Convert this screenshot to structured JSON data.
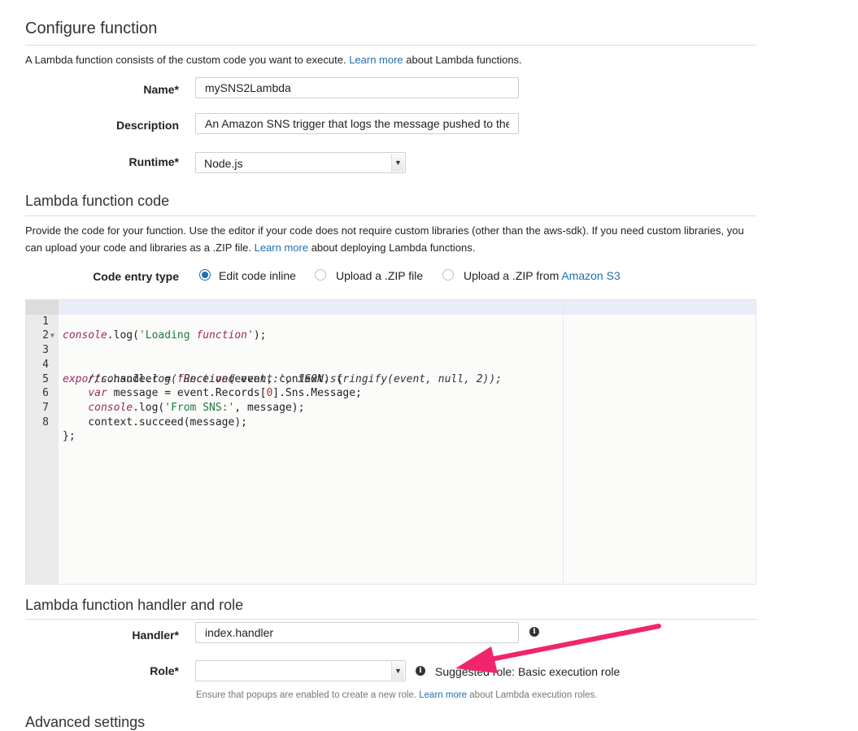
{
  "configure": {
    "title": "Configure function",
    "desc_before": "A Lambda function consists of the custom code you want to execute. ",
    "desc_link": "Learn more",
    "desc_after": " about Lambda functions.",
    "name_label": "Name*",
    "name_value": "mySNS2Lambda",
    "description_label": "Description",
    "description_value": "An Amazon SNS trigger that logs the message pushed to the",
    "runtime_label": "Runtime*",
    "runtime_value": "Node.js"
  },
  "code_section": {
    "title": "Lambda function code",
    "desc_before": "Provide the code for your function. Use the editor if your code does not require custom libraries (other than the aws-sdk). If you need custom libraries, you can upload your code and libraries as a .ZIP file. ",
    "desc_link": "Learn more",
    "desc_after": " about deploying Lambda functions.",
    "entry_type_label": "Code entry type",
    "options": [
      {
        "label": "Edit code inline",
        "selected": true
      },
      {
        "label": "Upload a .ZIP file",
        "selected": false
      },
      {
        "label_before": "Upload a .ZIP from ",
        "label_link": "Amazon S3",
        "selected": false
      }
    ]
  },
  "editor": {
    "line_numbers": [
      "1",
      "2",
      "3",
      "4",
      "5",
      "6",
      "7",
      "8"
    ],
    "lines": [
      "console.log('Loading function');",
      "",
      "exports.handler = function(event, context) {",
      "    //console.log('Received event:', JSON.stringify(event, null, 2));",
      "    var message = event.Records[0].Sns.Message;",
      "    console.log('From SNS:', message);",
      "    context.succeed(message);",
      "};"
    ]
  },
  "handler_section": {
    "title": "Lambda function handler and role",
    "handler_label": "Handler*",
    "handler_value": "index.handler",
    "role_label": "Role*",
    "role_value": "",
    "suggested_role": "Suggested role: Basic execution role",
    "note_before": "Ensure that popups are enabled to create a new role. ",
    "note_link": "Learn more",
    "note_after": " about Lambda execution roles."
  },
  "advanced": {
    "title": "Advanced settings"
  },
  "colors": {
    "link": "#1f6fb2",
    "annotation_arrow": "#f0266c"
  }
}
